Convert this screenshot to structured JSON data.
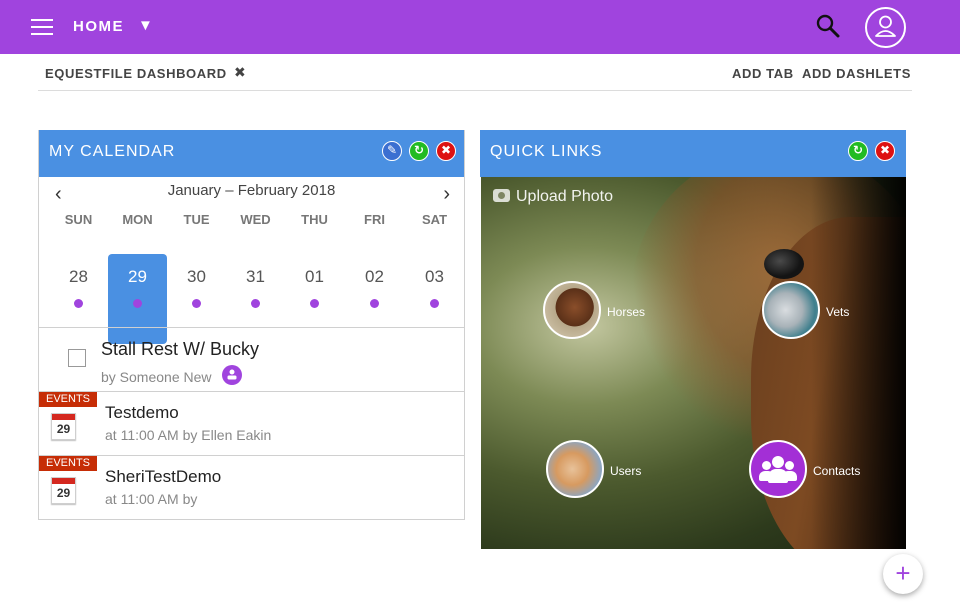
{
  "header": {
    "home_label": "HOME",
    "caret": "▼",
    "menu_icon": "hamburger-icon",
    "search_icon": "search-icon",
    "user_icon": "user-icon",
    "brand_color": "#a044de"
  },
  "tabbar": {
    "tab_label": "EQUESTFILE DASHBOARD",
    "tab_close": "✖",
    "add_tab": "ADD TAB",
    "add_dashlets": "ADD DASHLETS"
  },
  "calendar": {
    "title": "MY CALENDAR",
    "header_color": "#4a90e2",
    "range": "January – February 2018",
    "prev": "‹",
    "next": "›",
    "days": [
      {
        "dow": "SUN",
        "num": "28"
      },
      {
        "dow": "MON",
        "num": "29"
      },
      {
        "dow": "TUE",
        "num": "30"
      },
      {
        "dow": "WED",
        "num": "31"
      },
      {
        "dow": "THU",
        "num": "01"
      },
      {
        "dow": "FRI",
        "num": "02"
      },
      {
        "dow": "SAT",
        "num": "03"
      }
    ],
    "selected_day": "29",
    "items": [
      {
        "type": "task",
        "title": "Stall Rest W/ Bucky",
        "sub": "by Someone New"
      },
      {
        "type": "event",
        "badge": "EVENTS",
        "day": "29",
        "title": "Testdemo",
        "sub": "at 11:00 AM by Ellen Eakin"
      },
      {
        "type": "event",
        "badge": "EVENTS",
        "day": "29",
        "title": "SheriTestDemo",
        "sub": "at 11:00 AM by"
      }
    ]
  },
  "quick_links": {
    "title": "QUICK LINKS",
    "upload_label": "Upload Photo",
    "links": [
      {
        "label": "Horses"
      },
      {
        "label": "Vets"
      },
      {
        "label": "Users"
      },
      {
        "label": "Contacts"
      }
    ]
  },
  "fab": {
    "label": "+"
  }
}
